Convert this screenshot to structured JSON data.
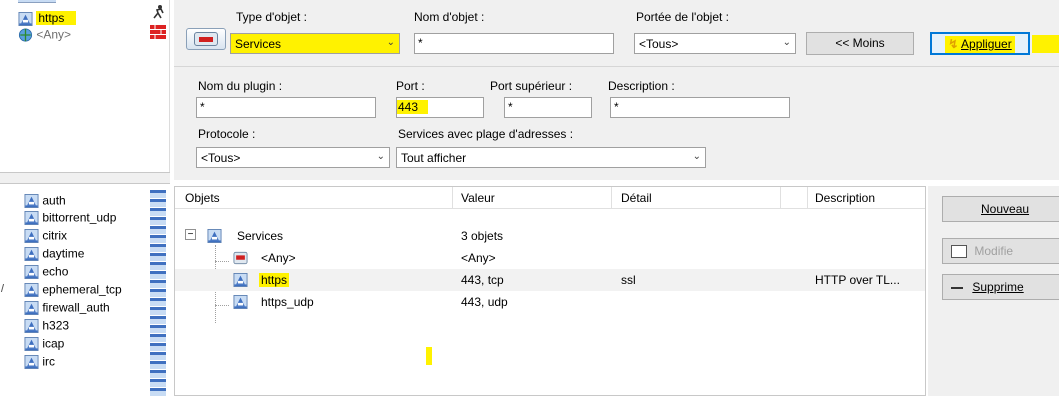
{
  "left_top": {
    "items": [
      {
        "label": "https",
        "highlight": true
      },
      {
        "label": "<Any>",
        "highlight": false
      }
    ]
  },
  "left_list": {
    "items": [
      "auth",
      "bittorrent_udp",
      "citrix",
      "daytime",
      "echo",
      "ephemeral_tcp",
      "firewall_auth",
      "h323",
      "icap",
      "irc"
    ]
  },
  "toolbar": {
    "type_label": "Type d'objet :",
    "type_value": "Services",
    "name_label": "Nom d'objet :",
    "name_value": "*",
    "scope_label": "Portée de l'objet :",
    "scope_value": "<Tous>",
    "less_button": "<< Moins",
    "apply_button": "Appliguer"
  },
  "filter": {
    "plugin_label": "Nom du plugin :",
    "plugin_value": "*",
    "port_label": "Port :",
    "port_value": "443",
    "port_sup_label": "Port supérieur :",
    "port_sup_value": "*",
    "desc_label": "Description :",
    "desc_value": "*",
    "protocol_label": "Protocole :",
    "protocol_value": "<Tous>",
    "range_label": "Services avec plage d'adresses :",
    "range_value": "Tout afficher"
  },
  "table": {
    "headers": [
      "Objets",
      "Valeur",
      "Détail",
      "Description"
    ],
    "group": {
      "label": "Services",
      "value": "3 objets"
    },
    "rows": [
      {
        "name": "<Any>",
        "value": "<Any>",
        "detail": "",
        "description": "",
        "highlight": false
      },
      {
        "name": "https",
        "value": "443, tcp",
        "detail": "ssl",
        "description": "HTTP over TL...",
        "highlight": true
      },
      {
        "name": "https_udp",
        "value": "443, udp",
        "detail": "",
        "description": "",
        "highlight": false
      }
    ]
  },
  "right_buttons": {
    "new": "Nouveau",
    "modify": "Modifie",
    "delete": "Supprime"
  },
  "colors": {
    "highlight": "#fff200",
    "panel": "#f0f0f0",
    "accent": "#0078d7"
  }
}
